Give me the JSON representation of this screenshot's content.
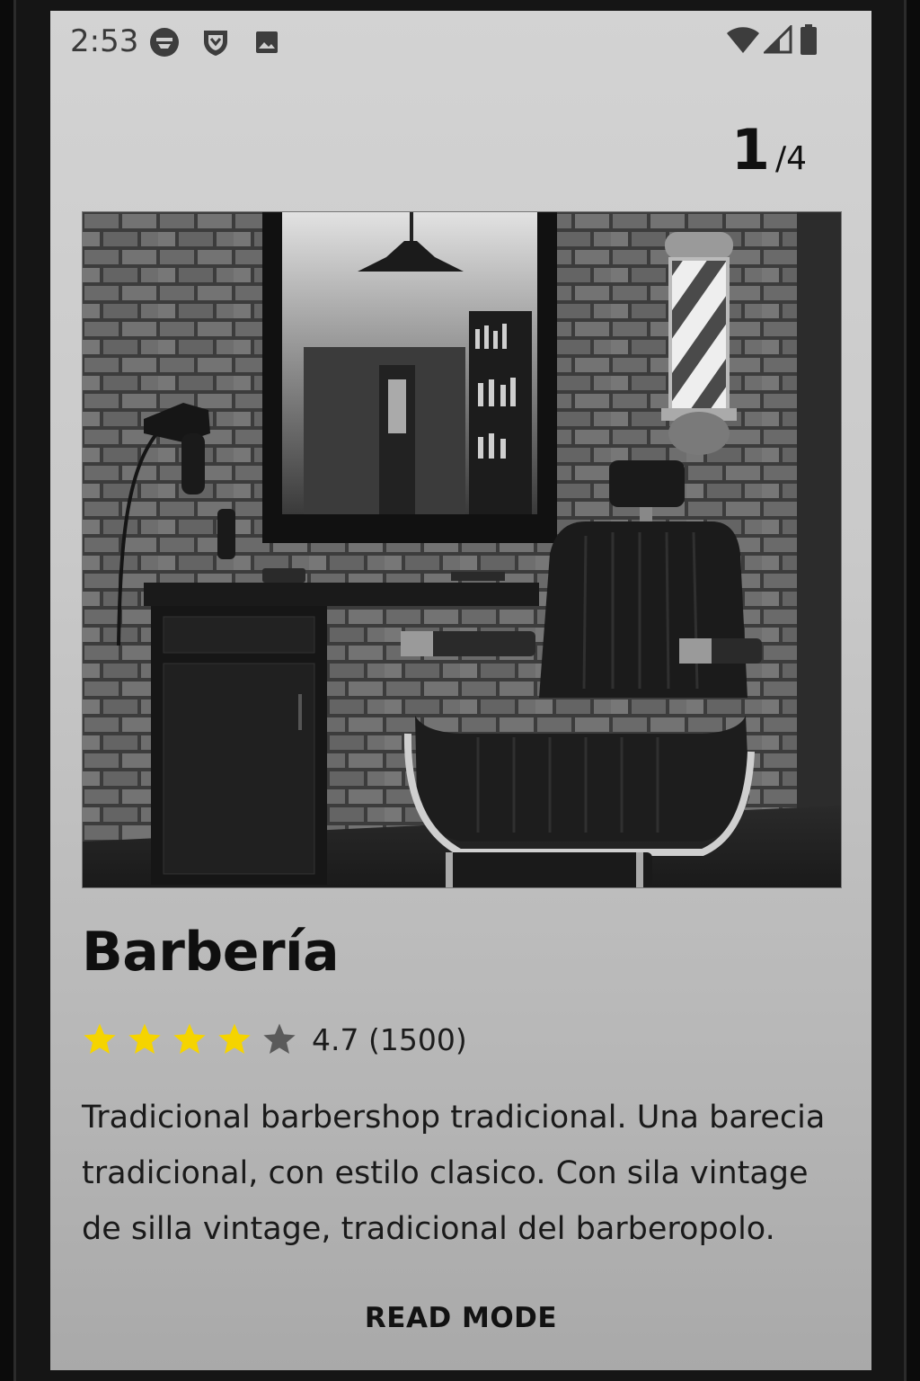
{
  "status_bar": {
    "time": "2:53",
    "left_icons": [
      "notification-icon",
      "shield-icon",
      "image-icon"
    ],
    "right_icons": [
      "wifi-icon",
      "signal-icon",
      "battery-icon"
    ]
  },
  "pager": {
    "current": "1",
    "total": "/4"
  },
  "place": {
    "photo_label": "barbershop-photo",
    "title": "Barbería",
    "rating": 4.7,
    "stars_filled": 4,
    "stars_total": 5,
    "rating_text": "4.7 (1500)",
    "description": "Tradicional barbershop tradicional. Una barecia tradicional, con estilo clasico. Con sila vintage de silla vintage, tradicional del barberopolo."
  },
  "actions": {
    "read_mode_label": "READ MODE"
  },
  "colors": {
    "star_filled": "#f5d400",
    "star_empty": "#5a5a5a",
    "text": "#111111"
  }
}
